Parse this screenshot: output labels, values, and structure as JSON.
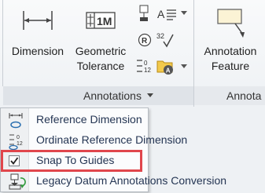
{
  "ribbon": {
    "dimension_label": "Dimension",
    "geometric_tolerance_line1": "Geometric",
    "geometric_tolerance_line2": "Tolerance",
    "annotation_feature_line1": "Annotation",
    "annotation_feature_line2": "Feature",
    "tol_icon_text": "1M",
    "group_annotations": "Annotations",
    "group_annotations_next": "Annota"
  },
  "menu": {
    "items": [
      {
        "label": "Reference Dimension",
        "icon": "reference-dimension-icon",
        "checked": false
      },
      {
        "label": "Ordinate Reference Dimension",
        "icon": "ordinate-reference-dimension-icon",
        "checked": false
      },
      {
        "label": "Snap To Guides",
        "icon": "checkmark-icon",
        "checked": true
      },
      {
        "label": "Legacy Datum Annotations Conversion",
        "icon": "legacy-datum-conversion-icon",
        "checked": false
      }
    ]
  },
  "colors": {
    "highlight": "#e0464c",
    "menu_text": "#243553",
    "icon_blue": "#2a6fb0"
  }
}
